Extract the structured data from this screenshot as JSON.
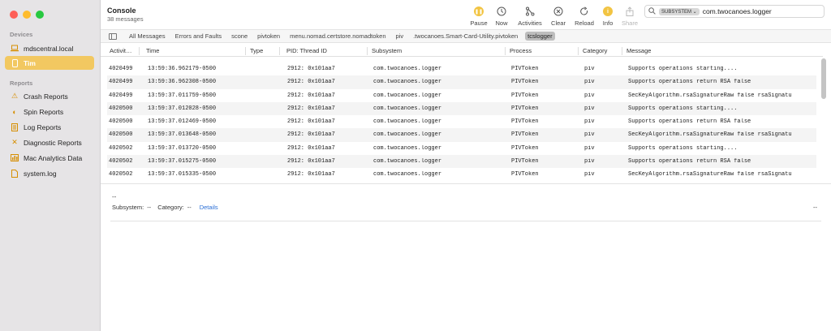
{
  "app": {
    "title": "Console",
    "message_count": "38 messages"
  },
  "sidebar": {
    "devices_label": "Devices",
    "devices": [
      {
        "label": "mdscentral.local",
        "icon": "laptop-icon",
        "selected": false
      },
      {
        "label": "Tim",
        "icon": "phone-icon",
        "selected": true
      }
    ],
    "reports_label": "Reports",
    "reports": [
      {
        "label": "Crash Reports",
        "icon": "warning-icon"
      },
      {
        "label": "Spin Reports",
        "icon": "spin-icon"
      },
      {
        "label": "Log Reports",
        "icon": "document-icon"
      },
      {
        "label": "Diagnostic Reports",
        "icon": "tools-icon"
      },
      {
        "label": "Mac Analytics Data",
        "icon": "chart-icon"
      },
      {
        "label": "system.log",
        "icon": "file-icon"
      }
    ]
  },
  "toolbar": {
    "pause": "Pause",
    "now": "Now",
    "activities": "Activities",
    "clear": "Clear",
    "reload": "Reload",
    "info": "Info",
    "share": "Share"
  },
  "search": {
    "token": "SUBSYSTEM ⌄",
    "value": "com.twocanoes.logger"
  },
  "filters": [
    {
      "label": "All Messages",
      "active": false
    },
    {
      "label": "Errors and Faults",
      "active": false
    },
    {
      "label": "scone",
      "active": false
    },
    {
      "label": "pivtoken",
      "active": false
    },
    {
      "label": "menu.nomad.certstore.nomadtoken",
      "active": false
    },
    {
      "label": "piv",
      "active": false
    },
    {
      "label": ".twocanoes.Smart-Card-Utility.pivtoken",
      "active": false
    },
    {
      "label": "tcslogger",
      "active": true
    }
  ],
  "columns": [
    "Activit…",
    "Time",
    "Type",
    "PID: Thread ID",
    "Subsystem",
    "Process",
    "Category",
    "Message"
  ],
  "rows": [
    [
      "4020499",
      "13:59:36.962179-0500",
      "",
      "2912: 0x101aa7",
      "com.twocanoes.logger",
      "PIVToken",
      "piv",
      "Supports operations starting...."
    ],
    [
      "4020499",
      "13:59:36.962308-0500",
      "",
      "2912: 0x101aa7",
      "com.twocanoes.logger",
      "PIVToken",
      "piv",
      "Supports operations return RSA false"
    ],
    [
      "4020499",
      "13:59:37.011759-0500",
      "",
      "2912: 0x101aa7",
      "com.twocanoes.logger",
      "PIVToken",
      "piv",
      "SecKeyAlgorithm.rsaSignatureRaw false  rsaSignatu"
    ],
    [
      "4020500",
      "13:59:37.012028-0500",
      "",
      "2912: 0x101aa7",
      "com.twocanoes.logger",
      "PIVToken",
      "piv",
      "Supports operations starting...."
    ],
    [
      "4020500",
      "13:59:37.012469-0500",
      "",
      "2912: 0x101aa7",
      "com.twocanoes.logger",
      "PIVToken",
      "piv",
      "Supports operations return RSA false"
    ],
    [
      "4020500",
      "13:59:37.013648-0500",
      "",
      "2912: 0x101aa7",
      "com.twocanoes.logger",
      "PIVToken",
      "piv",
      "SecKeyAlgorithm.rsaSignatureRaw false  rsaSignatu"
    ],
    [
      "4020502",
      "13:59:37.013720-0500",
      "",
      "2912: 0x101aa7",
      "com.twocanoes.logger",
      "PIVToken",
      "piv",
      "Supports operations starting...."
    ],
    [
      "4020502",
      "13:59:37.015275-0500",
      "",
      "2912: 0x101aa7",
      "com.twocanoes.logger",
      "PIVToken",
      "piv",
      "Supports operations return RSA false"
    ],
    [
      "4020502",
      "13:59:37.015335-0500",
      "",
      "2912: 0x101aa7",
      "com.twocanoes.logger",
      "PIVToken",
      "piv",
      "SecKeyAlgorithm.rsaSignatureRaw false  rsaSignatu"
    ]
  ],
  "detail": {
    "dash": "--",
    "subsystem_label": "Subsystem:",
    "subsystem_value": "--",
    "category_label": "Category:",
    "category_value": "--",
    "details_link": "Details",
    "right_value": "--"
  }
}
